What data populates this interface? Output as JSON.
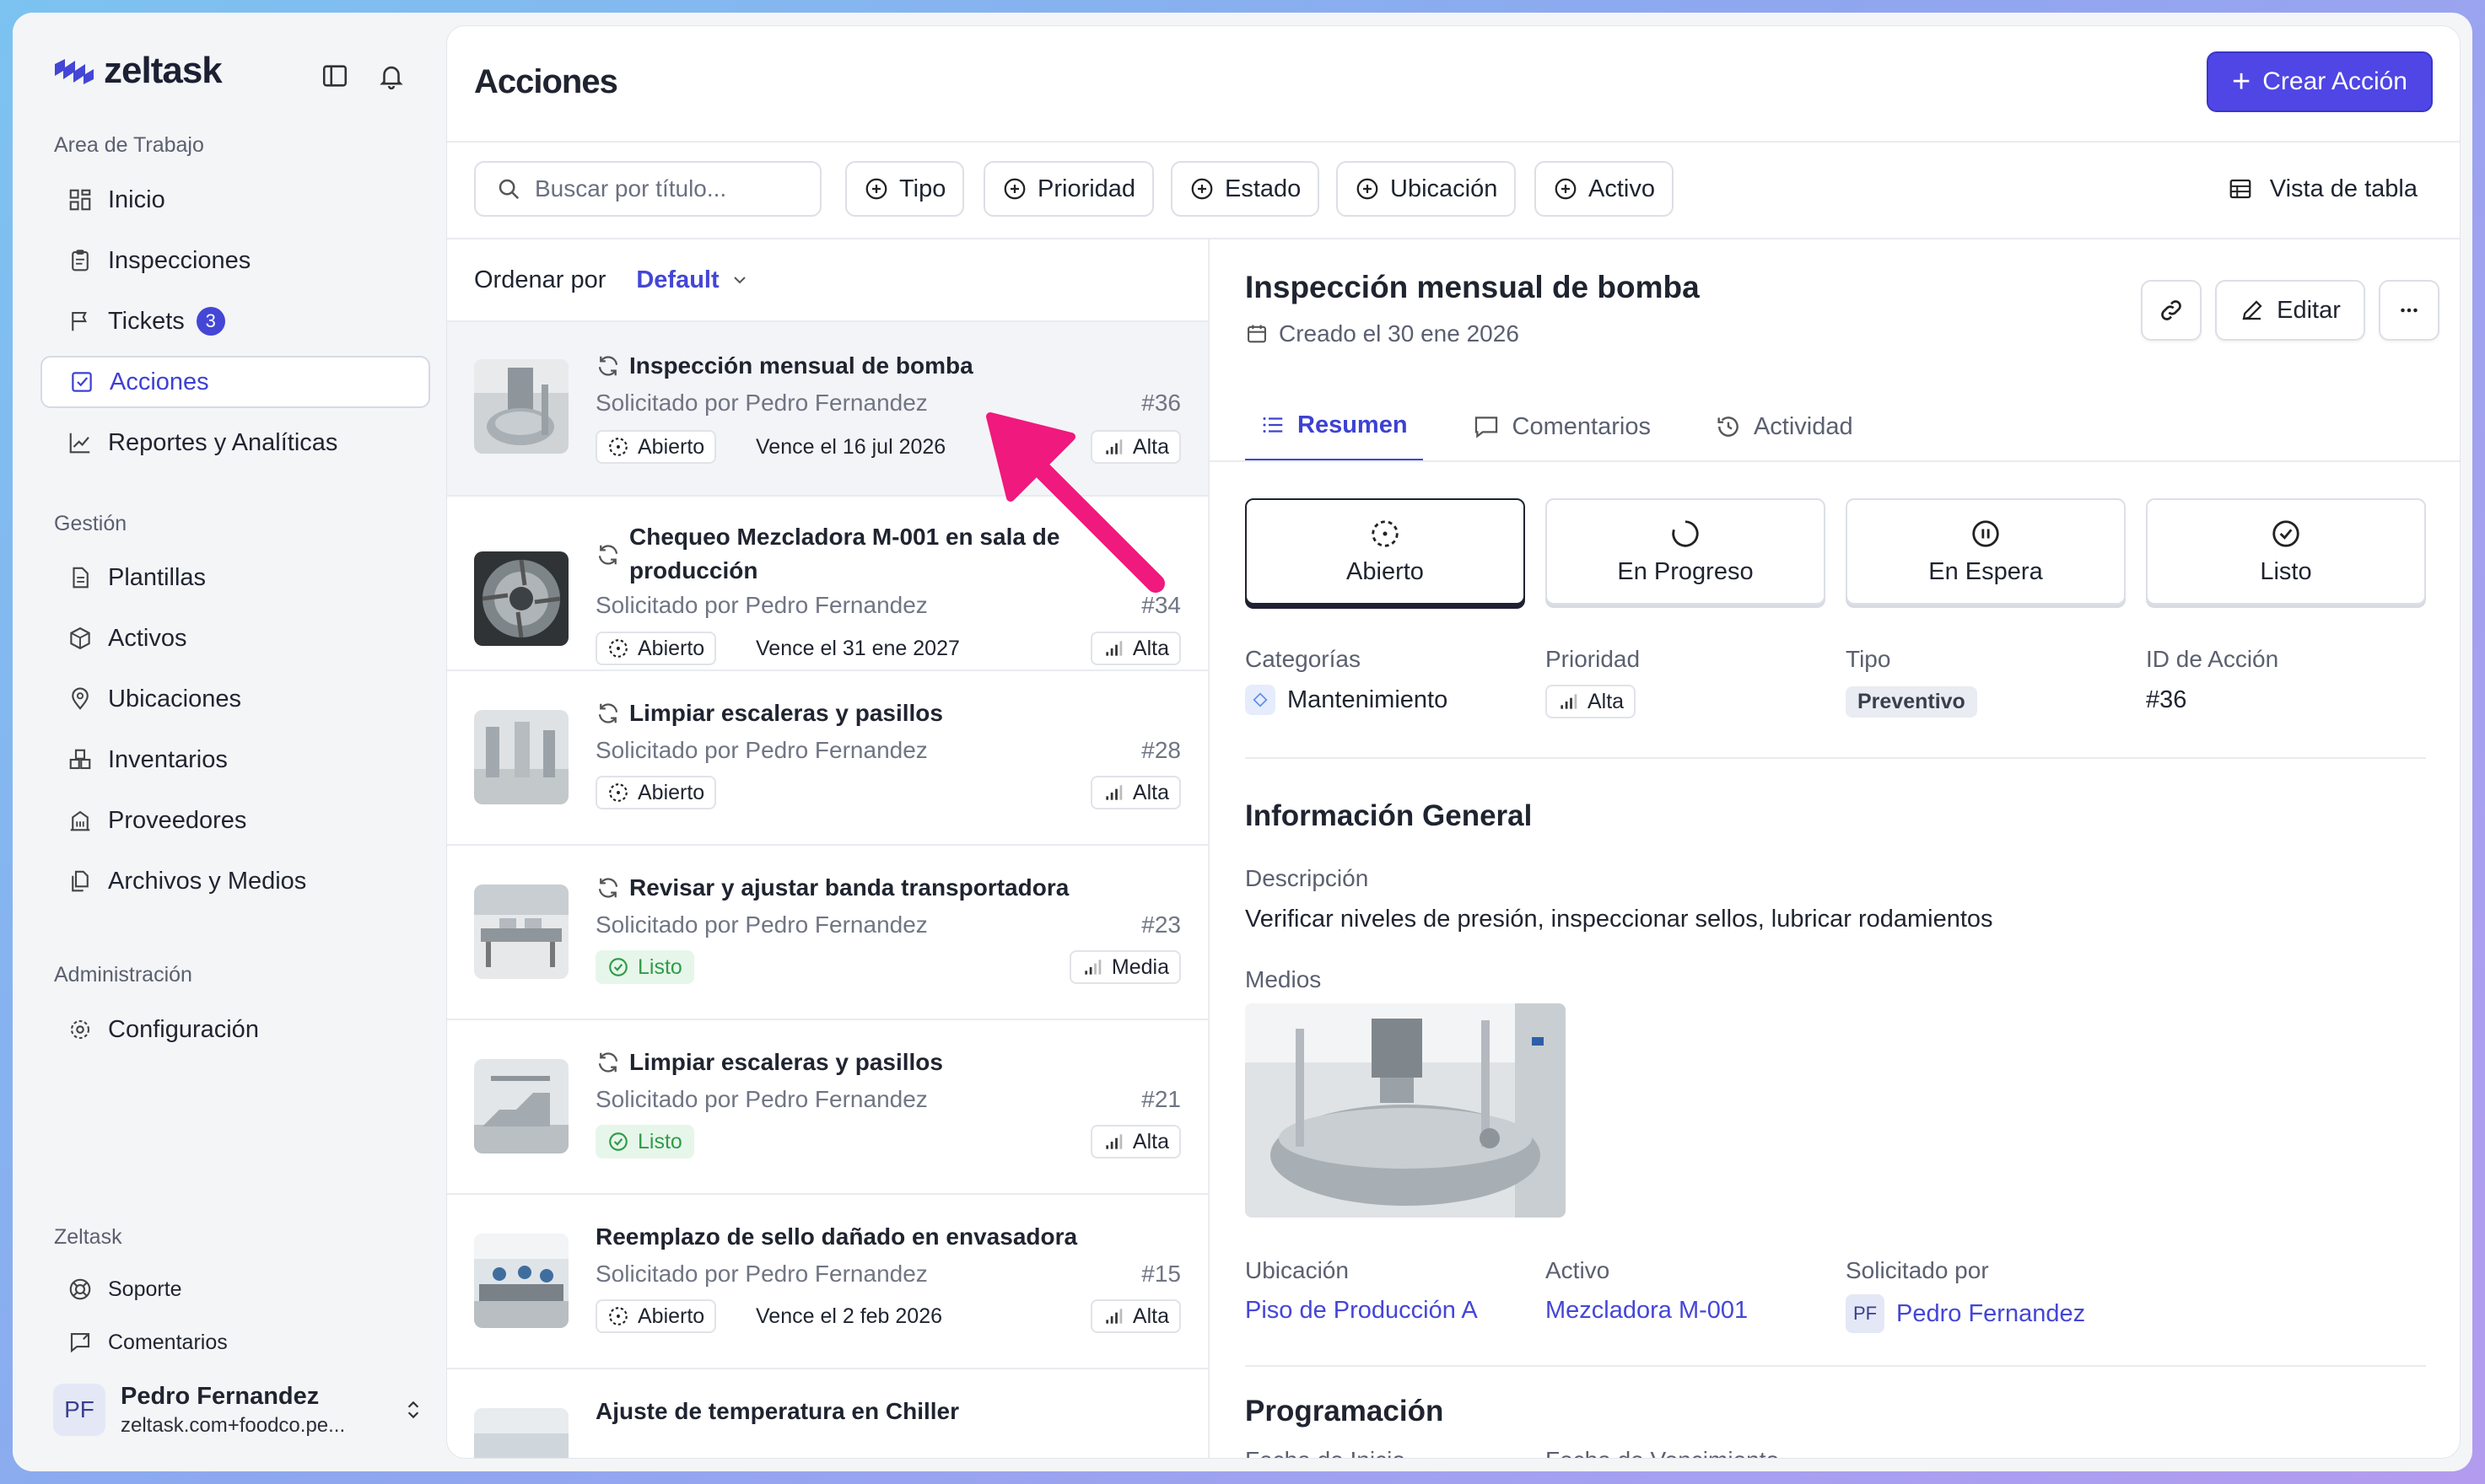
{
  "app": {
    "brand": "zeltask",
    "accent": "#4f46e5"
  },
  "sidebar": {
    "section_workspace": "Area de Trabajo",
    "section_management": "Gestión",
    "section_admin": "Administración",
    "section_zeltask": "Zeltask",
    "items": {
      "inicio": "Inicio",
      "inspecciones": "Inspecciones",
      "tickets": "Tickets",
      "tickets_badge": "3",
      "acciones": "Acciones",
      "reportes": "Reportes y Analíticas",
      "plantillas": "Plantillas",
      "activos": "Activos",
      "ubicaciones": "Ubicaciones",
      "inventarios": "Inventarios",
      "proveedores": "Proveedores",
      "archivos": "Archivos y Medios",
      "configuracion": "Configuración",
      "soporte": "Soporte",
      "comentarios": "Comentarios"
    },
    "user": {
      "initials": "PF",
      "name": "Pedro Fernandez",
      "email": "zeltask.com+foodco.pe..."
    }
  },
  "header": {
    "title": "Acciones",
    "create_label": "Crear Acción"
  },
  "filters": {
    "search_placeholder": "Buscar por título...",
    "chips": [
      "Tipo",
      "Prioridad",
      "Estado",
      "Ubicación",
      "Activo"
    ],
    "table_view": "Vista de tabla"
  },
  "list": {
    "sort_label": "Ordenar por",
    "sort_value": "Default",
    "rows": [
      {
        "title": "Inspección mensual de bomba",
        "requested": "Solicitado por Pedro Fernandez",
        "number": "#36",
        "status": "Abierto",
        "due": "Vence el 16 jul 2026",
        "priority": "Alta"
      },
      {
        "title": "Chequeo Mezcladora M-001 en sala de",
        "title2": "producción",
        "requested": "Solicitado por Pedro Fernandez",
        "number": "#34",
        "status": "Abierto",
        "due": "Vence el 31 ene 2027",
        "priority": "Alta"
      },
      {
        "title": "Limpiar escaleras y pasillos",
        "requested": "Solicitado por Pedro Fernandez",
        "number": "#28",
        "status": "Abierto",
        "due": "",
        "priority": "Alta"
      },
      {
        "title": "Revisar y ajustar banda transportadora",
        "requested": "Solicitado por Pedro Fernandez",
        "number": "#23",
        "status": "Listo",
        "due": "",
        "priority": "Media"
      },
      {
        "title": "Limpiar escaleras y pasillos",
        "requested": "Solicitado por Pedro Fernandez",
        "number": "#21",
        "status": "Listo",
        "due": "",
        "priority": "Alta"
      },
      {
        "title": "Reemplazo de sello dañado en envasadora",
        "requested": "Solicitado por Pedro Fernandez",
        "number": "#15",
        "status": "Abierto",
        "due": "Vence el 2 feb 2026",
        "priority": "Alta"
      },
      {
        "title": "Ajuste de temperatura en Chiller",
        "requested": "",
        "number": "",
        "status": "",
        "due": "",
        "priority": ""
      }
    ]
  },
  "detail": {
    "title": "Inspección mensual de bomba",
    "created": "Creado el 30 ene 2026",
    "edit_label": "Editar",
    "tabs": [
      "Resumen",
      "Comentarios",
      "Actividad"
    ],
    "statuses": [
      "Abierto",
      "En Progreso",
      "En Espera",
      "Listo"
    ],
    "active_status": "Abierto",
    "meta": {
      "categories_label": "Categorías",
      "categories_value": "Mantenimiento",
      "priority_label": "Prioridad",
      "priority_value": "Alta",
      "type_label": "Tipo",
      "type_value": "Preventivo",
      "id_label": "ID de Acción",
      "id_value": "#36"
    },
    "general_heading": "Información General",
    "description_label": "Descripción",
    "description_value": "Verificar niveles de presión, inspeccionar sellos, lubricar rodamientos",
    "media_label": "Medios",
    "location_label": "Ubicación",
    "location_value": "Piso de Producción A",
    "asset_label": "Activo",
    "asset_value": "Mezcladora M-001",
    "requested_label": "Solicitado por",
    "requested_initials": "PF",
    "requested_value": "Pedro Fernandez",
    "schedule_heading": "Programación",
    "start_label": "Fecha de Inicio",
    "due_label": "Fecha de Vencimiento"
  }
}
